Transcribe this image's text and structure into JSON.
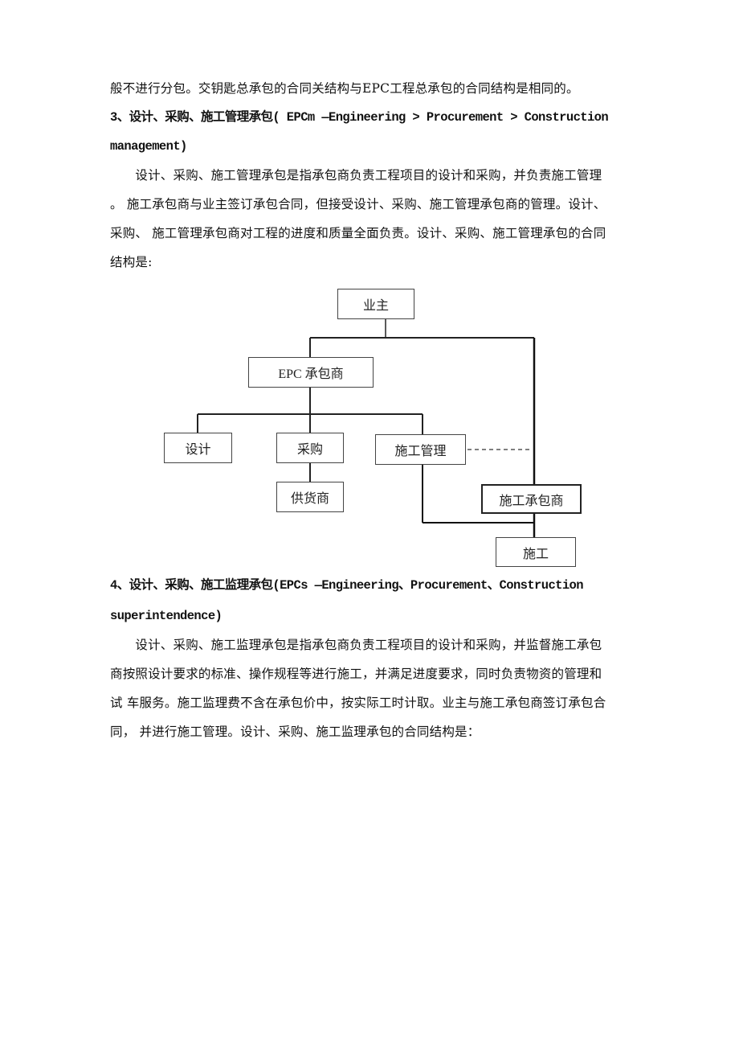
{
  "document": {
    "intro_line": "般不进行分包。交钥匙总承包的合同关结构与EPC工程总承包的合同结构是相同的。",
    "section3": {
      "heading_line1": "3、设计、采购、施工管理承包( EPCm —Engineering > Procurement > Construction",
      "heading_line2": "management)",
      "body_lines": [
        "　　设计、采购、施工管理承包是指承包商负责工程项目的设计和采购，并负责施工管理",
        "。 施工承包商与业主签订承包合同，但接受设计、采购、施工管理承包商的管理。设计、",
        "采购、 施工管理承包商对工程的进度和质量全面负责。设计、采购、施工管理承包的合同",
        "结构是:"
      ]
    },
    "diagram": {
      "nodes": {
        "owner": "业主",
        "epc_contractor": "EPC 承包商",
        "design": "设计",
        "procurement": "采购",
        "construction_management": "施工管理",
        "supplier": "供货商",
        "construction_contractor": "施工承包商",
        "construction": "施工"
      },
      "relations": [
        {
          "from": "owner",
          "to": "epc_contractor",
          "style": "solid"
        },
        {
          "from": "owner",
          "to": "construction_contractor",
          "style": "solid"
        },
        {
          "from": "epc_contractor",
          "to": "design",
          "style": "solid"
        },
        {
          "from": "epc_contractor",
          "to": "procurement",
          "style": "solid"
        },
        {
          "from": "epc_contractor",
          "to": "construction_management",
          "style": "solid"
        },
        {
          "from": "procurement",
          "to": "supplier",
          "style": "solid"
        },
        {
          "from": "construction_management",
          "to": "construction_contractor",
          "style": "dashed"
        },
        {
          "from": "construction_management",
          "to": "construction",
          "style": "solid"
        },
        {
          "from": "construction_contractor",
          "to": "construction",
          "style": "solid"
        }
      ]
    },
    "section4": {
      "heading_line1": "4、设计、采购、施工监理承包(EPCs —Engineering、Procurement、Construction",
      "heading_line2": "superintendence)",
      "body_lines": [
        "　　设计、采购、施工监理承包是指承包商负责工程项目的设计和采购，并监督施工承包",
        "商按照设计要求的标准、操作规程等进行施工，并满足进度要求，同时负责物资的管理和",
        "试 车服务。施工监理费不含在承包价中，按实际工时计取。业主与施工承包商签订承包合",
        "同， 并进行施工管理。设计、采购、施工监理承包的合同结构是："
      ]
    }
  }
}
